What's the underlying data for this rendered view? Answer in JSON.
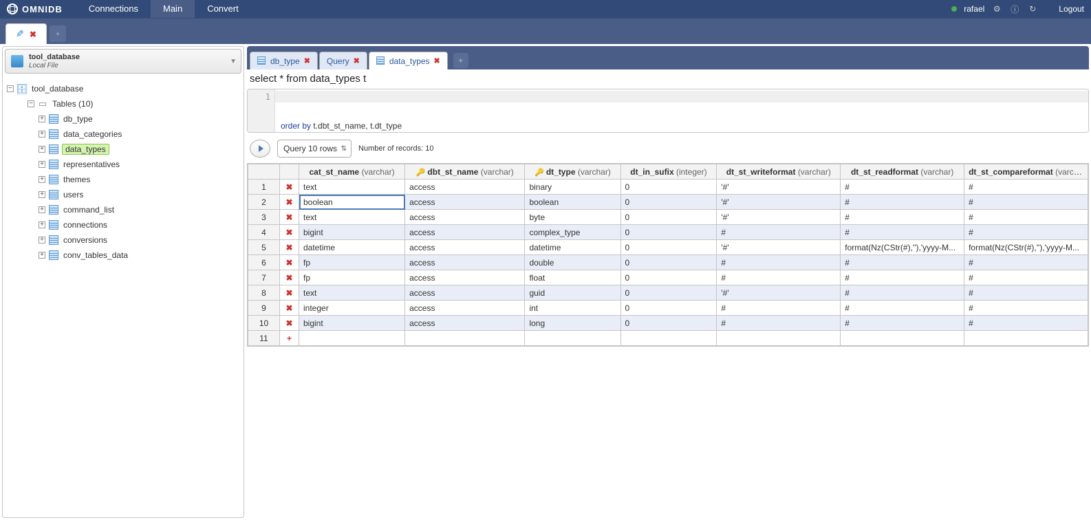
{
  "topnav": {
    "brand": "OMNIDB",
    "links": [
      "Connections",
      "Main",
      "Convert"
    ],
    "active_index": 1,
    "user": "rafael",
    "logout": "Logout"
  },
  "sidebar": {
    "header_title": "tool_database",
    "header_sub": "Local File",
    "root": "tool_database",
    "tables_label": "Tables (10)",
    "tables": [
      "db_type",
      "data_categories",
      "data_types",
      "representatives",
      "themes",
      "users",
      "command_list",
      "connections",
      "conversions",
      "conv_tables_data"
    ],
    "selected_table_index": 2
  },
  "inner_tabs": {
    "tabs": [
      {
        "label": "db_type",
        "icon": "table",
        "key": false
      },
      {
        "label": "Query",
        "icon": "none",
        "key": false
      },
      {
        "label": "data_types",
        "icon": "table",
        "key": false
      }
    ],
    "active_index": 2
  },
  "query": {
    "heading": "select * from data_types t",
    "line_no": "1",
    "sql": {
      "pre": "order by",
      "rest": " t.dbt_st_name, t.dt_type"
    }
  },
  "toolbar": {
    "rows_label": "Query 10 rows",
    "rec_count": "Number of records: 10"
  },
  "grid": {
    "columns": [
      {
        "name": "cat_st_name",
        "type": "(varchar)",
        "key": false
      },
      {
        "name": "dbt_st_name",
        "type": "(varchar)",
        "key": true
      },
      {
        "name": "dt_type",
        "type": "(varchar)",
        "key": true
      },
      {
        "name": "dt_in_sufix",
        "type": "(integer)",
        "key": false
      },
      {
        "name": "dt_st_writeformat",
        "type": "(varchar)",
        "key": false
      },
      {
        "name": "dt_st_readformat",
        "type": "(varchar)",
        "key": false
      },
      {
        "name": "dt_st_compareformat",
        "type": "(varchar)",
        "key": false
      }
    ],
    "editing": {
      "row": 1,
      "col": 0
    },
    "rows": [
      [
        "text",
        "access",
        "binary",
        "0",
        "'#'",
        "#",
        "#"
      ],
      [
        "boolean",
        "access",
        "boolean",
        "0",
        "'#'",
        "#",
        "#"
      ],
      [
        "text",
        "access",
        "byte",
        "0",
        "'#'",
        "#",
        "#"
      ],
      [
        "bigint",
        "access",
        "complex_type",
        "0",
        "#",
        "#",
        "#"
      ],
      [
        "datetime",
        "access",
        "datetime",
        "0",
        "'#'",
        "format(Nz(CStr(#),''),'yyyy-M...",
        "format(Nz(CStr(#),''),'yyyy-M..."
      ],
      [
        "fp",
        "access",
        "double",
        "0",
        "#",
        "#",
        "#"
      ],
      [
        "fp",
        "access",
        "float",
        "0",
        "#",
        "#",
        "#"
      ],
      [
        "text",
        "access",
        "guid",
        "0",
        "'#'",
        "#",
        "#"
      ],
      [
        "integer",
        "access",
        "int",
        "0",
        "#",
        "#",
        "#"
      ],
      [
        "bigint",
        "access",
        "long",
        "0",
        "#",
        "#",
        "#"
      ]
    ],
    "extra_row_num": "11"
  }
}
